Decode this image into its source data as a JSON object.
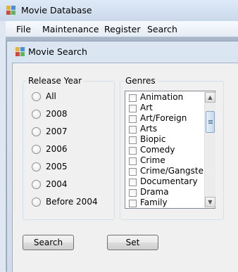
{
  "window": {
    "title": "Movie Database"
  },
  "menu": [
    "File",
    "Maintenance",
    "Register",
    "Search"
  ],
  "child_window": {
    "title": "Movie Search"
  },
  "release_year": {
    "label": "Release Year",
    "options": [
      "All",
      "2008",
      "2007",
      "2006",
      "2005",
      "2004",
      "Before 2004"
    ]
  },
  "genres": {
    "label": "Genres",
    "items": [
      "Animation",
      "Art",
      "Art/Foreign",
      "Arts",
      "Biopic",
      "Comedy",
      "Crime",
      "Crime/Gangster",
      "Documentary",
      "Drama",
      "Family"
    ]
  },
  "buttons": {
    "search": "Search",
    "set": "Set"
  },
  "icons": {
    "app": "app-icon",
    "scroll_up": "scroll-up-icon",
    "scroll_down": "scroll-down-icon"
  }
}
